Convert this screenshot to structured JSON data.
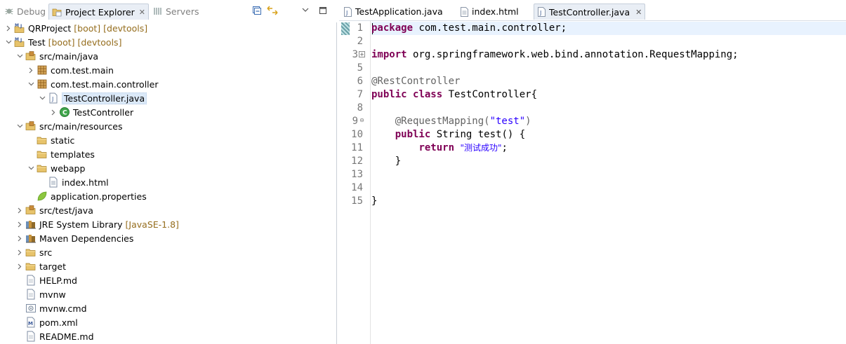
{
  "left_tabs": {
    "debug": "Debug",
    "project_explorer": "Project Explorer",
    "servers": "Servers"
  },
  "tree": [
    {
      "label": "QRProject",
      "deco": "[boot] [devtools]",
      "icon": "maven-project-icon",
      "arrow": "collapsed",
      "level": 0
    },
    {
      "label": "Test",
      "deco": "[boot] [devtools]",
      "icon": "maven-project-icon",
      "arrow": "expanded",
      "level": 0
    },
    {
      "label": "src/main/java",
      "icon": "source-folder-icon",
      "arrow": "expanded",
      "level": 1
    },
    {
      "label": "com.test.main",
      "icon": "package-icon",
      "arrow": "collapsed",
      "level": 2
    },
    {
      "label": "com.test.main.controller",
      "icon": "package-icon",
      "arrow": "expanded",
      "level": 2
    },
    {
      "label": "TestController.java",
      "icon": "java-file-icon",
      "arrow": "expanded",
      "level": 3,
      "selected": true
    },
    {
      "label": "TestController",
      "icon": "class-icon",
      "arrow": "collapsed",
      "level": 4
    },
    {
      "label": "src/main/resources",
      "icon": "source-folder-icon",
      "arrow": "expanded",
      "level": 1
    },
    {
      "label": "static",
      "icon": "folder-icon",
      "arrow": "none",
      "level": 2
    },
    {
      "label": "templates",
      "icon": "folder-icon",
      "arrow": "none",
      "level": 2
    },
    {
      "label": "webapp",
      "icon": "folder-icon",
      "arrow": "expanded",
      "level": 2
    },
    {
      "label": "index.html",
      "icon": "html-file-icon",
      "arrow": "none",
      "level": 3
    },
    {
      "label": "application.properties",
      "icon": "properties-file-icon",
      "arrow": "none",
      "level": 2
    },
    {
      "label": "src/test/java",
      "icon": "source-folder-icon",
      "arrow": "collapsed",
      "level": 1
    },
    {
      "label": "JRE System Library",
      "deco": "[JavaSE-1.8]",
      "icon": "library-icon",
      "arrow": "collapsed",
      "level": 1
    },
    {
      "label": "Maven Dependencies",
      "icon": "library-icon",
      "arrow": "collapsed",
      "level": 1
    },
    {
      "label": "src",
      "icon": "folder-icon",
      "arrow": "collapsed",
      "level": 1
    },
    {
      "label": "target",
      "icon": "folder-icon",
      "arrow": "collapsed",
      "level": 1
    },
    {
      "label": "HELP.md",
      "icon": "text-file-icon",
      "arrow": "none",
      "level": 1
    },
    {
      "label": "mvnw",
      "icon": "text-file-icon",
      "arrow": "none",
      "level": 1
    },
    {
      "label": "mvnw.cmd",
      "icon": "cmd-file-icon",
      "arrow": "none",
      "level": 1
    },
    {
      "label": "pom.xml",
      "icon": "pom-file-icon",
      "arrow": "none",
      "level": 1
    },
    {
      "label": "README.md",
      "icon": "text-file-icon",
      "arrow": "none",
      "level": 1
    }
  ],
  "editor_tabs": [
    {
      "label": "TestApplication.java",
      "icon": "java-file-icon",
      "active": false
    },
    {
      "label": "index.html",
      "icon": "html-file-icon",
      "active": false
    },
    {
      "label": "TestController.java",
      "icon": "java-file-icon",
      "active": true
    }
  ],
  "line_numbers": [
    "1",
    "2",
    "3",
    "5",
    "6",
    "7",
    "8",
    "9",
    "10",
    "11",
    "12",
    "13",
    "14",
    "15"
  ],
  "code": {
    "l1_kw": "package",
    "l1_rest": " com.test.main.controller;",
    "l3_kw": "import",
    "l3_rest": " org.springframework.web.bind.annotation.RequestMapping;",
    "l6": "@RestController",
    "l7_kw1": "public",
    "l7_kw2": "class",
    "l7_rest": " TestController{",
    "l9_an": "@RequestMapping(",
    "l9_str": "\"test\"",
    "l9_end": ")",
    "l10_kw": "public",
    "l10_rest": " String test() {",
    "l11_kw": "return",
    "l11_str": "\"测试成功\"",
    "l11_end": ";",
    "l12": "}",
    "l15": "}"
  }
}
